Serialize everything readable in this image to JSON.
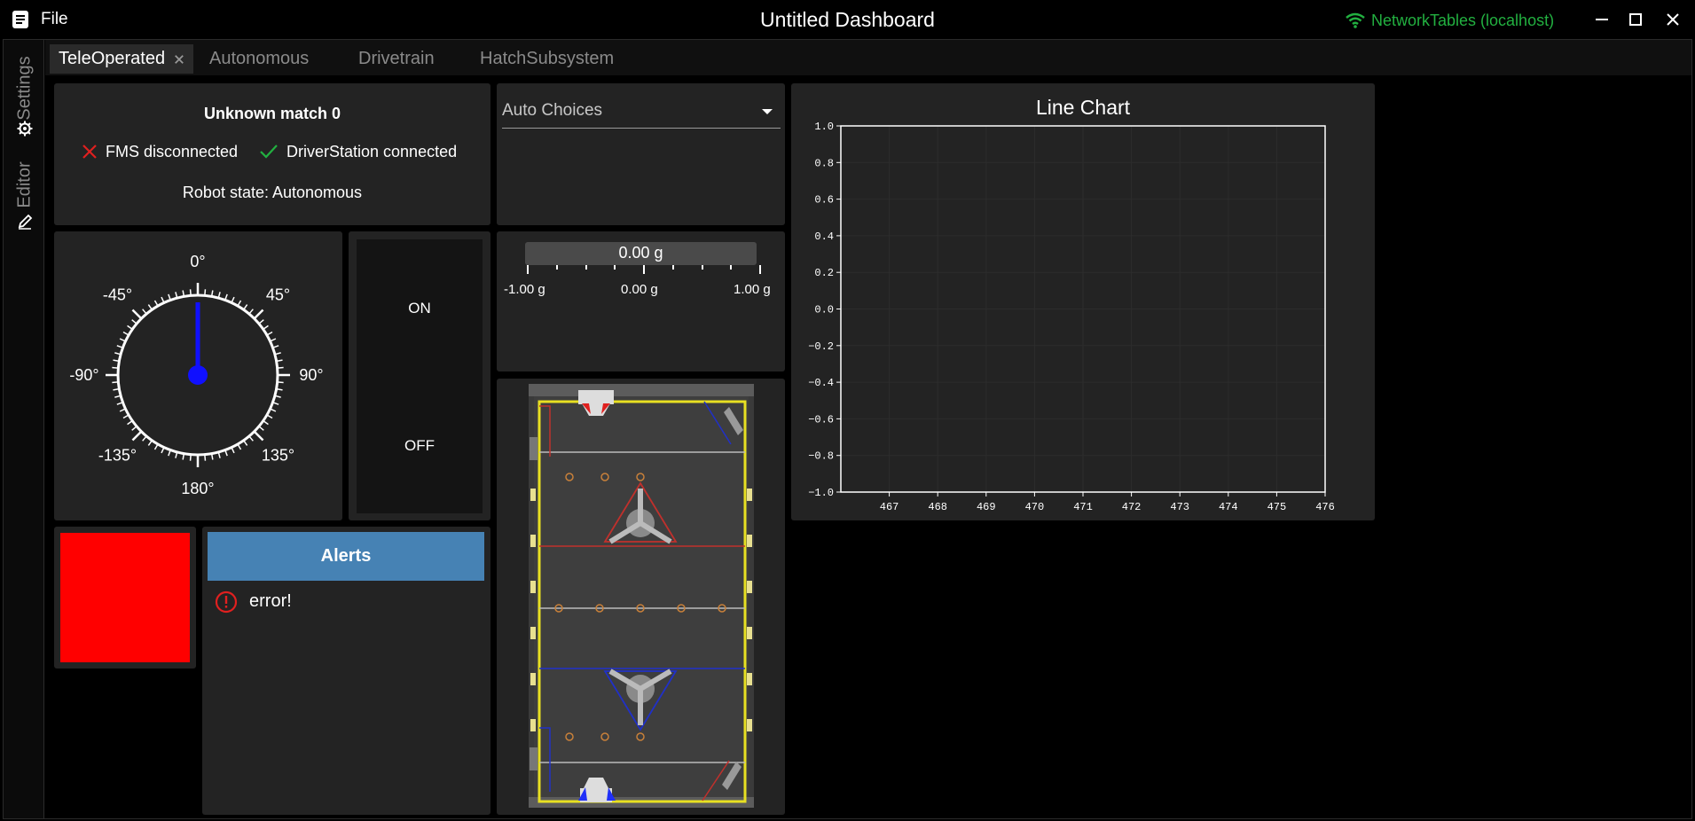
{
  "app": {
    "file_label": "File",
    "title": "Untitled Dashboard",
    "network_status": "NetworkTables (localhost)",
    "network_color": "#22b040"
  },
  "side_tabs": {
    "settings": "Settings",
    "editor": "Editor"
  },
  "tabs": [
    {
      "label": "TeleOperated",
      "active": true
    },
    {
      "label": "Autonomous"
    },
    {
      "label": "Drivetrain"
    },
    {
      "label": "HatchSubsystem"
    }
  ],
  "fms": {
    "match": "Unknown match 0",
    "fms_status": "FMS disconnected",
    "ds_status": "DriverStation connected",
    "robot_state": "Robot state: Autonomous"
  },
  "gyro": {
    "value_deg": 0,
    "labels": [
      "0°",
      "45°",
      "90°",
      "135°",
      "180°",
      "-135°",
      "-90°",
      "-45°"
    ]
  },
  "toggle": {
    "on": "ON",
    "off": "OFF"
  },
  "chooser": {
    "selected": "Auto Choices"
  },
  "accel": {
    "value": "0.00 g",
    "min_label": "-1.00 g",
    "mid_label": "0.00 g",
    "max_label": "1.00 g",
    "fraction": 0.5
  },
  "boolean_box": {
    "color": "#ff0000"
  },
  "alerts": {
    "title": "Alerts",
    "items": [
      {
        "text": "error!"
      }
    ],
    "header_color": "#4682b4",
    "error_color": "#e0201f"
  },
  "chart_data": {
    "type": "line",
    "title": "Line Chart",
    "series": [],
    "xlim": [
      466,
      476
    ],
    "ylim": [
      -1.0,
      1.0
    ],
    "x_ticks": [
      "467",
      "468",
      "469",
      "470",
      "471",
      "472",
      "473",
      "474",
      "475",
      "476"
    ],
    "y_ticks": [
      "1.0",
      "0.8",
      "0.6",
      "0.4",
      "0.2",
      "0.0",
      "−0.2",
      "−0.4",
      "−0.6",
      "−0.8",
      "−1.0"
    ],
    "grid": true
  }
}
